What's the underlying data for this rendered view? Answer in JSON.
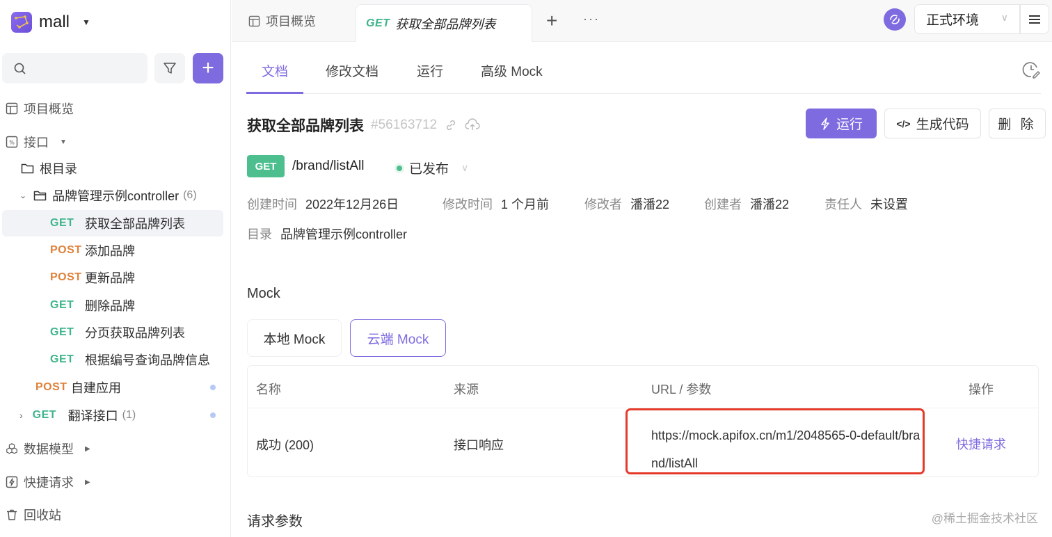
{
  "project": {
    "name": "mall"
  },
  "sidebar": {
    "search_placeholder": "",
    "nav": {
      "overview": "项目概览",
      "interfaces": "接口",
      "data_models": "数据模型",
      "quick_requests": "快捷请求",
      "recycle_bin": "回收站"
    },
    "tree": [
      {
        "type": "folder",
        "label": "根目录"
      },
      {
        "type": "folder",
        "label": "品牌管理示例controller",
        "count": "(6)"
      },
      {
        "method": "GET",
        "label": "获取全部品牌列表",
        "active": true
      },
      {
        "method": "POST",
        "label": "添加品牌"
      },
      {
        "method": "POST",
        "label": "更新品牌"
      },
      {
        "method": "GET",
        "label": "删除品牌"
      },
      {
        "method": "GET",
        "label": "分页获取品牌列表"
      },
      {
        "method": "GET",
        "label": "根据编号查询品牌信息"
      },
      {
        "method": "POST",
        "label": "自建应用"
      },
      {
        "method": "GET",
        "label": "翻译接口",
        "count": "(1)"
      }
    ]
  },
  "tabs": {
    "overview": "项目概览",
    "active_method": "GET",
    "active_label": "获取全部品牌列表",
    "plus": "+",
    "more": "···"
  },
  "env": {
    "selected": "正式环境",
    "chevron": "∨"
  },
  "subtabs": [
    "文档",
    "修改文档",
    "运行",
    "高级 Mock"
  ],
  "api": {
    "title": "获取全部品牌列表",
    "id": "#56163712",
    "method": "GET",
    "path": "/brand/listAll",
    "status": "已发布",
    "actions": {
      "run": "运行",
      "gen_code": "生成代码",
      "delete": "删 除"
    },
    "meta": [
      {
        "key": "创建时间",
        "value": "2022年12月26日"
      },
      {
        "key": "修改时间",
        "value": "1 个月前"
      },
      {
        "key": "修改者",
        "value": "潘潘22"
      },
      {
        "key": "创建者",
        "value": "潘潘22"
      },
      {
        "key": "责任人",
        "value": "未设置"
      }
    ],
    "dir_key": "目录",
    "dir_value": "品牌管理示例controller"
  },
  "mock": {
    "title": "Mock",
    "tabs": {
      "local": "本地 Mock",
      "cloud": "云端 Mock"
    },
    "columns": {
      "name": "名称",
      "source": "来源",
      "url": "URL / 参数",
      "action": "操作"
    },
    "rows": [
      {
        "name": "成功 (200)",
        "source": "接口响应",
        "url": "https://mock.apifox.cn/m1/2048565-0-default/brand/listAll",
        "action": "快捷请求"
      }
    ]
  },
  "request_params_title": "请求参数",
  "watermark": "@稀土掘金技术社区",
  "colors": {
    "accent": "#7f6be0",
    "get": "#3fb58a",
    "post": "#e0813a",
    "highlight": "#e53a2a"
  }
}
